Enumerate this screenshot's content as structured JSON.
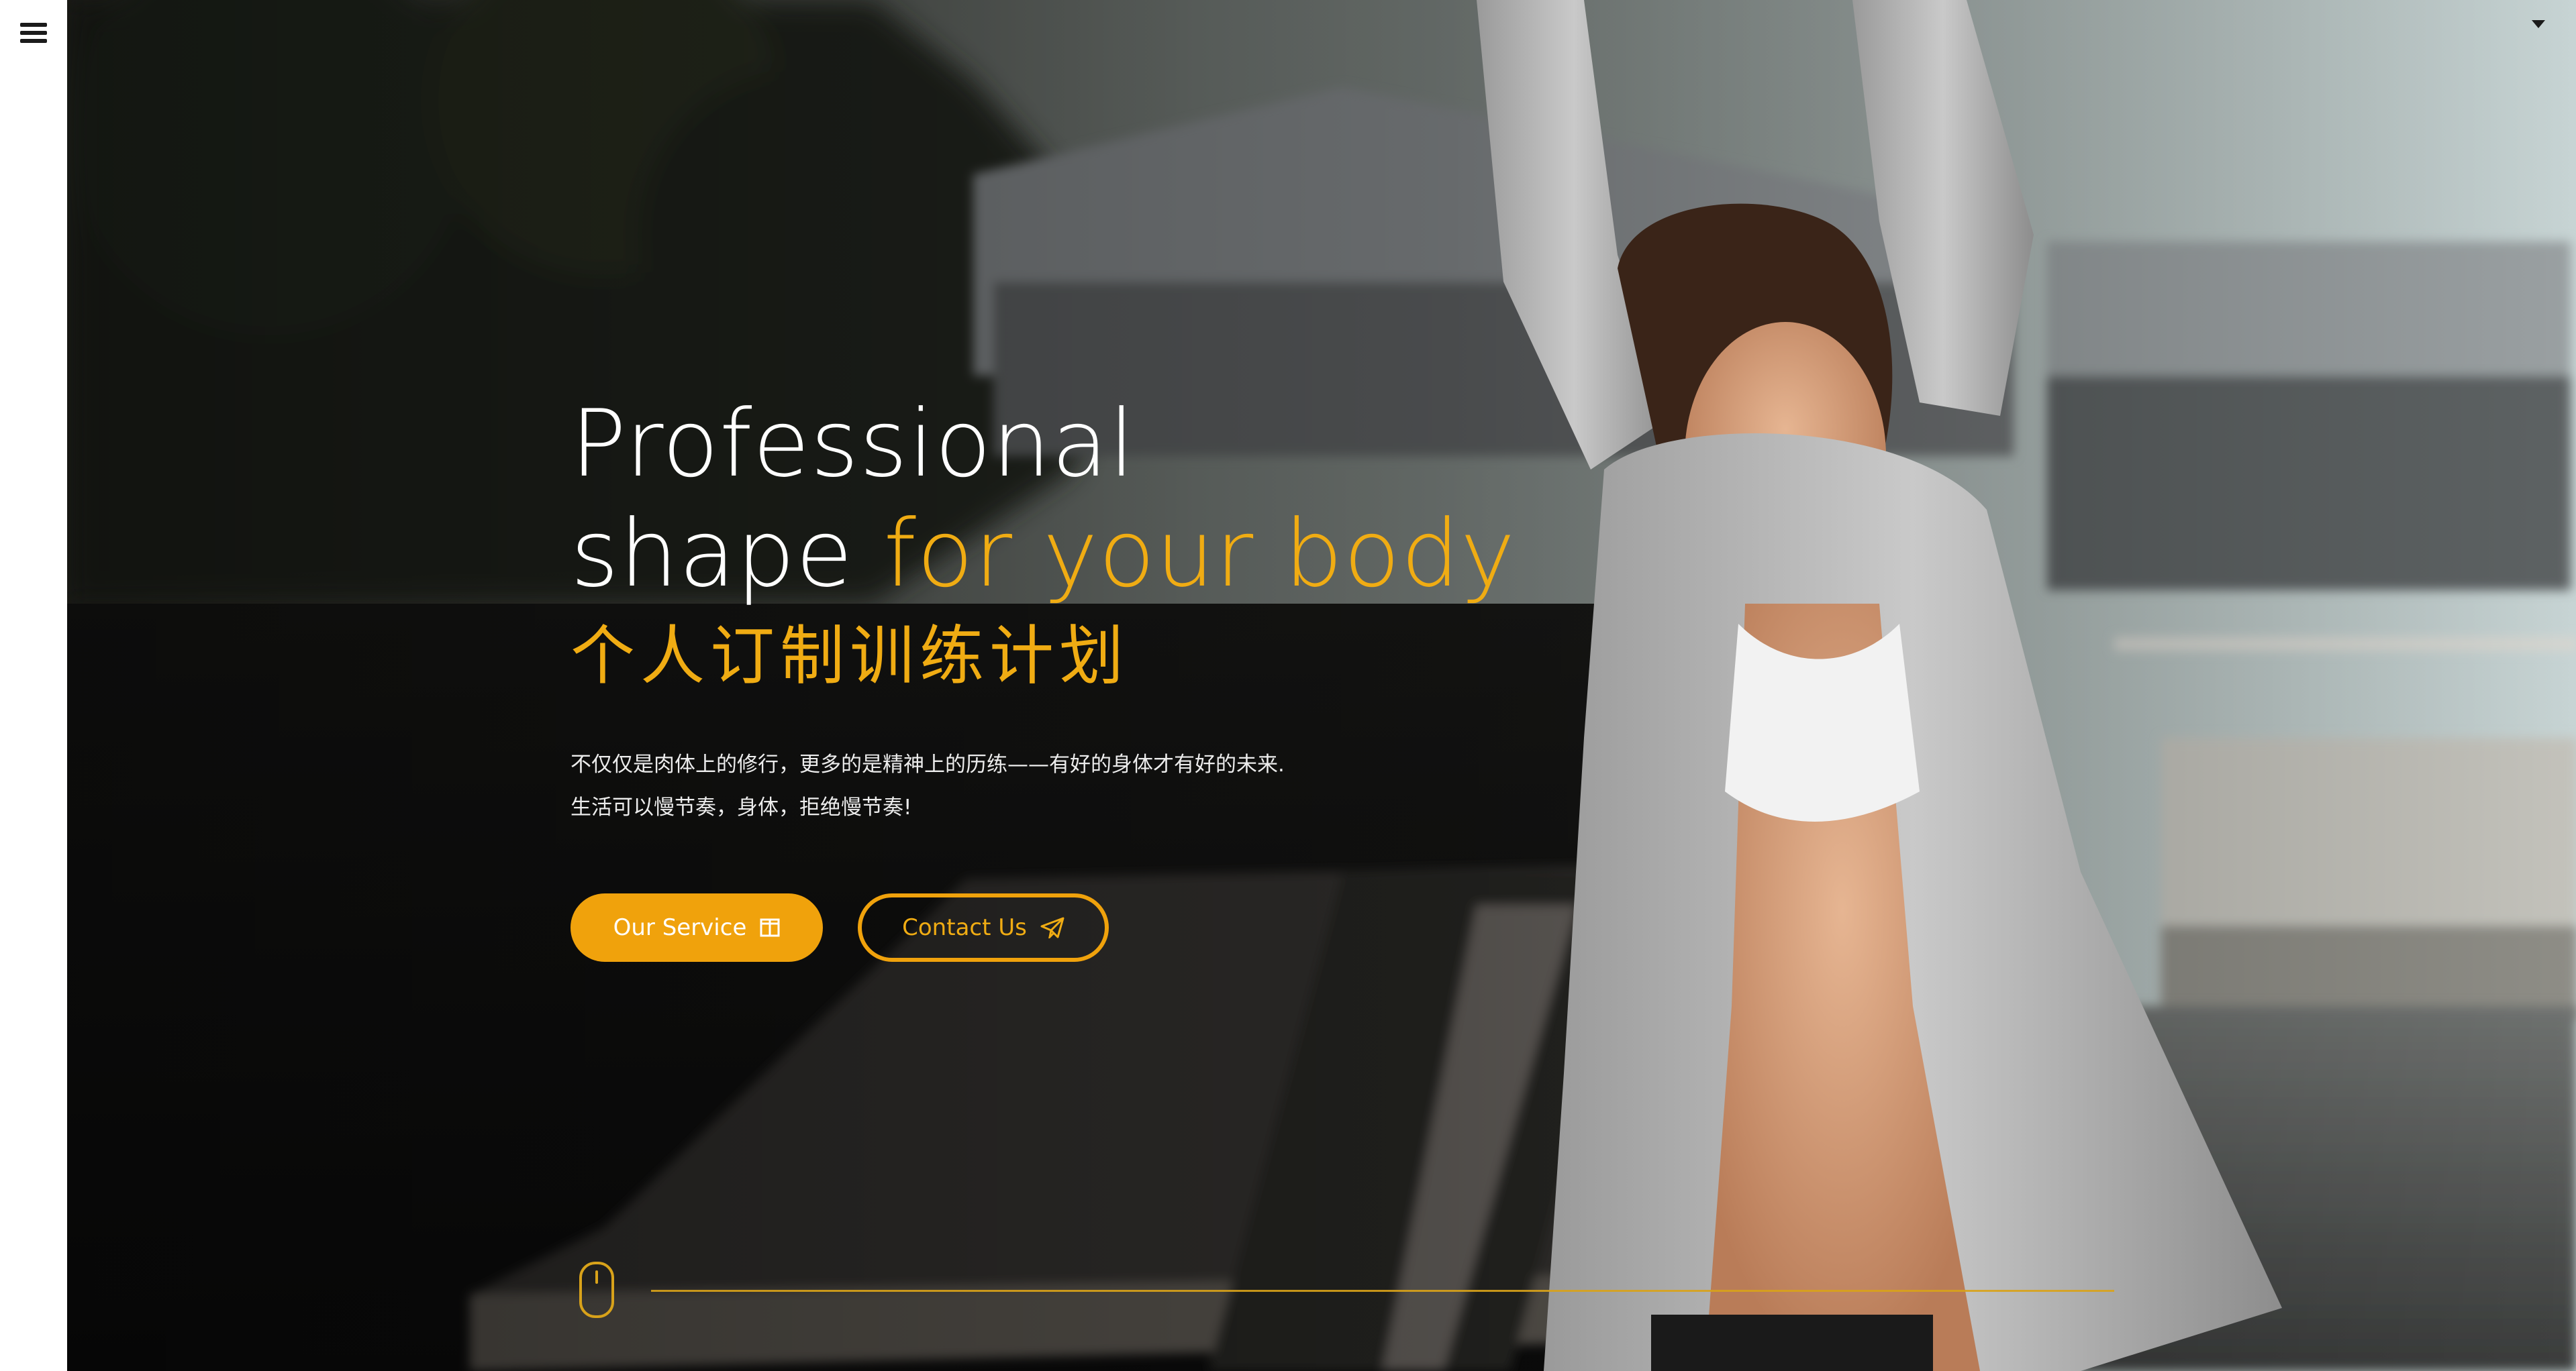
{
  "nav": {
    "menu_icon": "hamburger-menu-icon",
    "corner_icon": "caret-down-icon"
  },
  "hero": {
    "headline_line1": "Professional",
    "headline_line2_plain": "shape ",
    "headline_line2_accent": "for your body",
    "subtitle_cn": "个人订制训练计划",
    "description_line1": "不仅仅是肉体上的修行，更多的是精神上的历练——有好的身体才有好的未来.",
    "description_line2": "生活可以慢节奏，身体，拒绝慢节奏!",
    "primary_button": {
      "label": "Our Service",
      "icon": "columns-icon"
    },
    "secondary_button": {
      "label": "Contact Us",
      "icon": "paper-plane-icon"
    },
    "scroll_icon": "mouse-scroll-icon"
  },
  "colors": {
    "accent": "#f0ac13",
    "accent_button": "#f0a20c",
    "text_light": "#ffffff",
    "sidebar_bg": "#ffffff"
  }
}
